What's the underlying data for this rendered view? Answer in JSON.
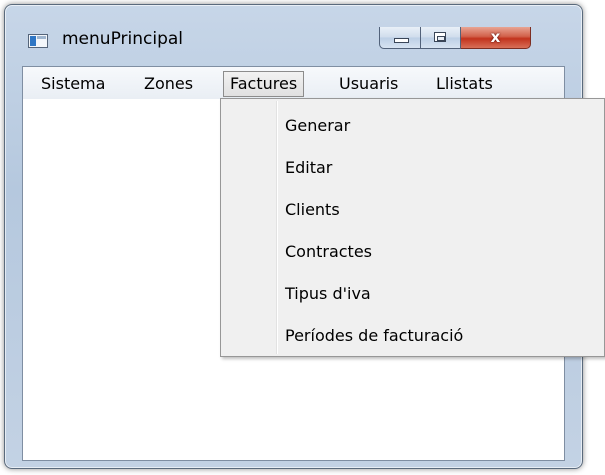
{
  "window": {
    "title": "menuPrincipal",
    "icon": "app-window-icon",
    "controls": {
      "minimize": "minimize-icon",
      "maximize": "maximize-icon",
      "close": "close-icon",
      "close_glyph": "x"
    }
  },
  "menubar": {
    "items": [
      {
        "label": "Sistema",
        "active": false
      },
      {
        "label": "Zones",
        "active": false
      },
      {
        "label": "Factures",
        "active": true
      },
      {
        "label": "Usuaris",
        "active": false
      },
      {
        "label": "Llistats",
        "active": false
      }
    ]
  },
  "dropdown": {
    "items": [
      {
        "label": "Generar"
      },
      {
        "label": "Editar"
      },
      {
        "label": "Clients"
      },
      {
        "label": "Contractes"
      },
      {
        "label": "Tipus d'iva"
      },
      {
        "label": "Períodes de facturació"
      }
    ]
  },
  "colors": {
    "frame": "#b5c8de",
    "close_button": "#c2331d",
    "menu_background": "#f0f0f0"
  }
}
